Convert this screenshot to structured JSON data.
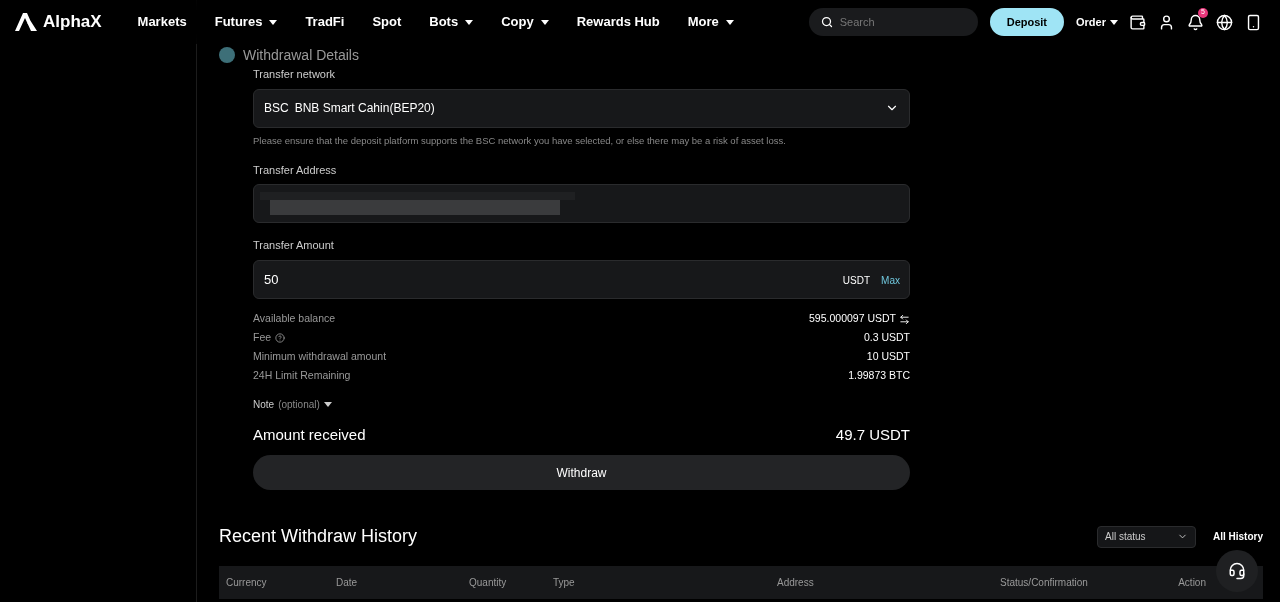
{
  "header": {
    "logo": "AlphaX",
    "nav": [
      {
        "label": "Markets",
        "dropdown": false
      },
      {
        "label": "Futures",
        "dropdown": true
      },
      {
        "label": "TradFi",
        "dropdown": false
      },
      {
        "label": "Spot",
        "dropdown": false
      },
      {
        "label": "Bots",
        "dropdown": true
      },
      {
        "label": "Copy",
        "dropdown": true
      },
      {
        "label": "Rewards Hub",
        "dropdown": false
      },
      {
        "label": "More",
        "dropdown": true
      }
    ],
    "search": {
      "placeholder": "Search"
    },
    "deposit": "Deposit",
    "order": "Order",
    "notification_count": "5"
  },
  "section": {
    "title": "Withdrawal Details"
  },
  "network": {
    "label": "Transfer network",
    "code": "BSC",
    "name": "BNB Smart Cahin(BEP20)",
    "warning": "Please ensure that the deposit platform supports the BSC network you have selected, or else there may be a risk of asset loss."
  },
  "address": {
    "label": "Transfer Address"
  },
  "amount": {
    "label": "Transfer Amount",
    "value": "50",
    "unit": "USDT",
    "max": "Max"
  },
  "details": [
    {
      "label": "Available balance",
      "value": "595.000097 USDT",
      "kind": "swap"
    },
    {
      "label": "Fee",
      "value": "0.3 USDT",
      "kind": "help"
    },
    {
      "label": "Minimum withdrawal amount",
      "value": "10 USDT",
      "kind": "plain"
    },
    {
      "label": "24H Limit Remaining",
      "value": "1.99873 BTC",
      "kind": "plain"
    }
  ],
  "note": {
    "label": "Note",
    "hint": "(optional)"
  },
  "received": {
    "label": "Amount received",
    "value": "49.7 USDT"
  },
  "withdraw_button": "Withdraw",
  "history": {
    "title": "Recent Withdraw History",
    "filter": "All status",
    "all_link": "All History",
    "columns": [
      "Currency",
      "Date",
      "Quantity",
      "Type",
      "Address",
      "Status/Confirmation",
      "Action"
    ]
  }
}
